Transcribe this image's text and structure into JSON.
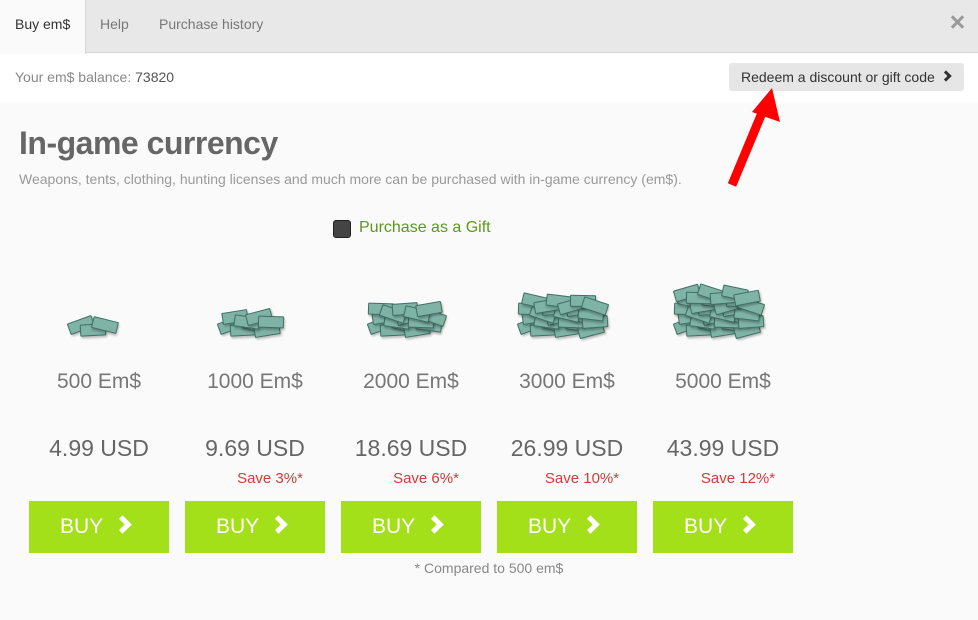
{
  "tabs": [
    {
      "label": "Buy em$",
      "active": true
    },
    {
      "label": "Help",
      "active": false
    },
    {
      "label": "Purchase history",
      "active": false
    }
  ],
  "balance": {
    "label": "Your em$ balance:",
    "value": "73820"
  },
  "redeem": {
    "label": "Redeem a discount or gift code"
  },
  "heading": {
    "title": "In-game currency",
    "subtitle": "Weapons, tents, clothing, hunting licenses and much more can be purchased with in-game currency (em$)."
  },
  "gift": {
    "label": "Purchase as a Gift",
    "checked": false
  },
  "packages": [
    {
      "amount": "500 Em$",
      "price": "4.99 USD",
      "save": "",
      "buy": "BUY",
      "stacks": 1
    },
    {
      "amount": "1000 Em$",
      "price": "9.69 USD",
      "save": "Save 3%*",
      "buy": "BUY",
      "stacks": 2
    },
    {
      "amount": "2000 Em$",
      "price": "18.69 USD",
      "save": "Save 6%*",
      "buy": "BUY",
      "stacks": 3
    },
    {
      "amount": "3000 Em$",
      "price": "26.99 USD",
      "save": "Save 10%*",
      "buy": "BUY",
      "stacks": 4
    },
    {
      "amount": "5000 Em$",
      "price": "43.99 USD",
      "save": "Save 12%*",
      "buy": "BUY",
      "stacks": 5
    }
  ],
  "footnote": "* Compared to 500 em$",
  "colors": {
    "buy_button": "#a3e01a",
    "save_text": "#d43a3a",
    "gift_label": "#5a9a1a",
    "annotation_arrow": "#ff0000"
  },
  "icons": {
    "close": "close-icon",
    "redeem_chevron": "chevron-right-icon",
    "buy_chevron": "chevron-right-icon",
    "annotation": "red-arrow-icon"
  }
}
